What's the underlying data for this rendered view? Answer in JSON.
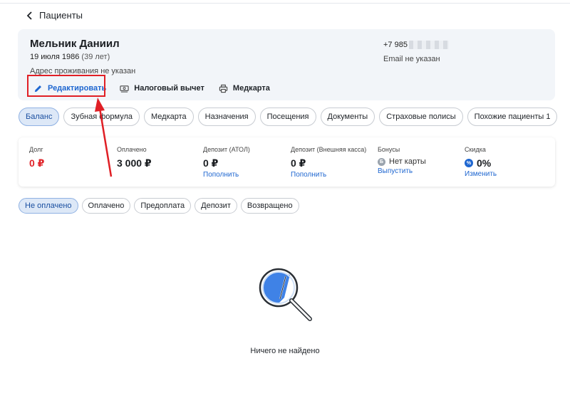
{
  "header": {
    "back_label": "Пациенты"
  },
  "patient": {
    "name": "Мельник Даниил",
    "dob": "19 июля 1986",
    "age": "(39 лет)",
    "address": "Адрес проживания не указан",
    "phone": "+7 985",
    "email": "Email не указан"
  },
  "actions": {
    "edit": "Редактировать",
    "tax": "Налоговый вычет",
    "medcard": "Медкарта"
  },
  "tabs": [
    {
      "label": "Баланс",
      "active": true
    },
    {
      "label": "Зубная формула"
    },
    {
      "label": "Медкарта"
    },
    {
      "label": "Назначения"
    },
    {
      "label": "Посещения"
    },
    {
      "label": "Документы"
    },
    {
      "label": "Страховые полисы"
    },
    {
      "label": "Похожие пациенты 1"
    }
  ],
  "balance": {
    "debt": {
      "label": "Долг",
      "value": "0 ₽"
    },
    "paid": {
      "label": "Оплачено",
      "value": "3 000 ₽"
    },
    "deposit_atol": {
      "label": "Депозит (АТОЛ)",
      "value": "0 ₽",
      "link": "Пополнить"
    },
    "deposit_ext": {
      "label": "Депозит (Внешняя касса)",
      "value": "0 ₽",
      "link": "Пополнить"
    },
    "bonus": {
      "label": "Бонусы",
      "value": "Нет карты",
      "link": "Выпустить",
      "icon_text": "Б"
    },
    "discount": {
      "label": "Скидка",
      "value": "0%",
      "link": "Изменить",
      "icon_text": "%"
    }
  },
  "filters": [
    {
      "label": "Не оплачено",
      "active": true
    },
    {
      "label": "Оплачено"
    },
    {
      "label": "Предоплата"
    },
    {
      "label": "Депозит"
    },
    {
      "label": "Возвращено"
    }
  ],
  "empty_state": {
    "text": "Ничего не найдено"
  },
  "colors": {
    "accent": "#1e66d0",
    "danger": "#e0242a",
    "highlight": "#e01f25",
    "card_bg": "#f2f5f9"
  }
}
